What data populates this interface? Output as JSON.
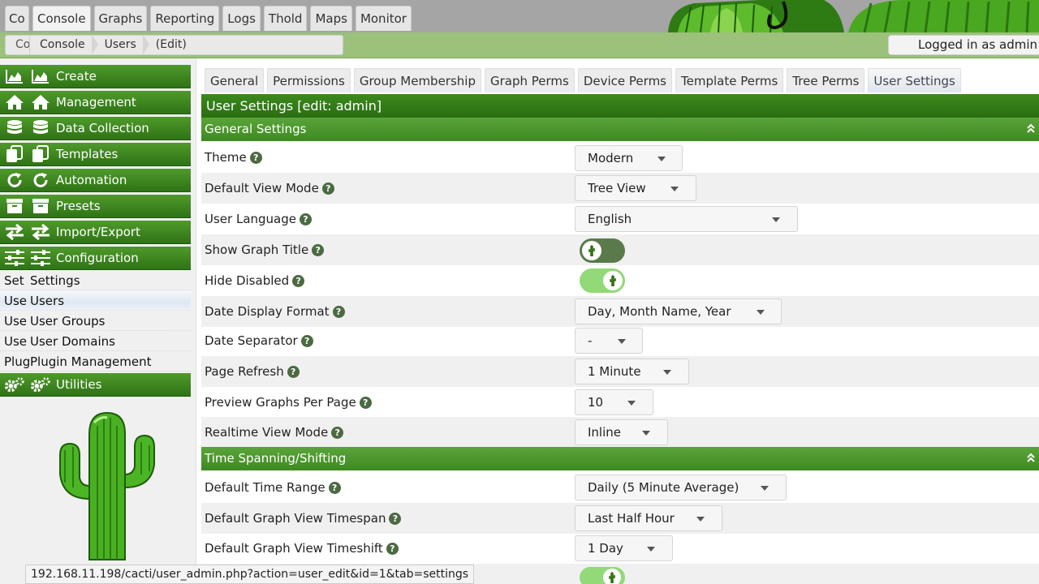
{
  "top_tabs": [
    {
      "label": "Console",
      "abbr": "Co"
    },
    {
      "label": "Console"
    },
    {
      "label": "Graphs"
    },
    {
      "label": "Reporting"
    },
    {
      "label": "Logs"
    },
    {
      "label": "Thold"
    },
    {
      "label": "Maps"
    },
    {
      "label": "Monitor"
    }
  ],
  "breadcrumb": {
    "abbr": "Co",
    "items": [
      "Console",
      "Users",
      "(Edit)"
    ]
  },
  "login": "Logged in as admin",
  "sidebar": {
    "headers": {
      "create": "Create",
      "management": "Management",
      "data_collection": "Data Collection",
      "templates": "Templates",
      "automation": "Automation",
      "presets": "Presets",
      "import_export": "Import/Export",
      "configuration": "Configuration",
      "utilities": "Utilities"
    },
    "items": [
      {
        "abbr": "Set",
        "label": "Settings"
      },
      {
        "abbr": "Use",
        "label": "Users"
      },
      {
        "abbr": "Use",
        "label": "User Groups"
      },
      {
        "abbr": "Use",
        "label": "User Domains"
      },
      {
        "abbr": "Plug",
        "label": "Plugin Management"
      }
    ]
  },
  "tabs": [
    "General",
    "Permissions",
    "Group Membership",
    "Graph Perms",
    "Device Perms",
    "Template Perms",
    "Tree Perms",
    "User Settings"
  ],
  "title": "User Settings [edit: admin]",
  "sections": {
    "general": "General Settings",
    "time": "Time Spanning/Shifting"
  },
  "fields": {
    "theme": {
      "label": "Theme",
      "value": "Modern"
    },
    "view_mode": {
      "label": "Default View Mode",
      "value": "Tree View"
    },
    "language": {
      "label": "User Language",
      "value": "English"
    },
    "show_title": {
      "label": "Show Graph Title",
      "state": "on"
    },
    "hide_disabled": {
      "label": "Hide Disabled",
      "state": "off"
    },
    "date_format": {
      "label": "Date Display Format",
      "value": "Day, Month Name, Year"
    },
    "date_sep": {
      "label": "Date Separator",
      "value": "-"
    },
    "page_refresh": {
      "label": "Page Refresh",
      "value": "1 Minute"
    },
    "preview_graphs": {
      "label": "Preview Graphs Per Page",
      "value": "10"
    },
    "realtime_mode": {
      "label": "Realtime View Mode",
      "value": "Inline"
    },
    "time_range": {
      "label": "Default Time Range",
      "value": "Daily (5 Minute Average)"
    },
    "timespan": {
      "label": "Default Graph View Timespan",
      "value": "Last Half Hour"
    },
    "timeshift": {
      "label": "Default Graph View Timeshift",
      "value": "1 Day"
    }
  },
  "help_glyph": "?",
  "status_url": "192.168.11.198/cacti/user_admin.php?action=user_edit&id=1&tab=settings",
  "colors": {
    "primary_green": "#3c8a1d",
    "section_green": "#5aa43a",
    "toggle_on": "#5a7a4b",
    "toggle_off": "#92d978"
  }
}
